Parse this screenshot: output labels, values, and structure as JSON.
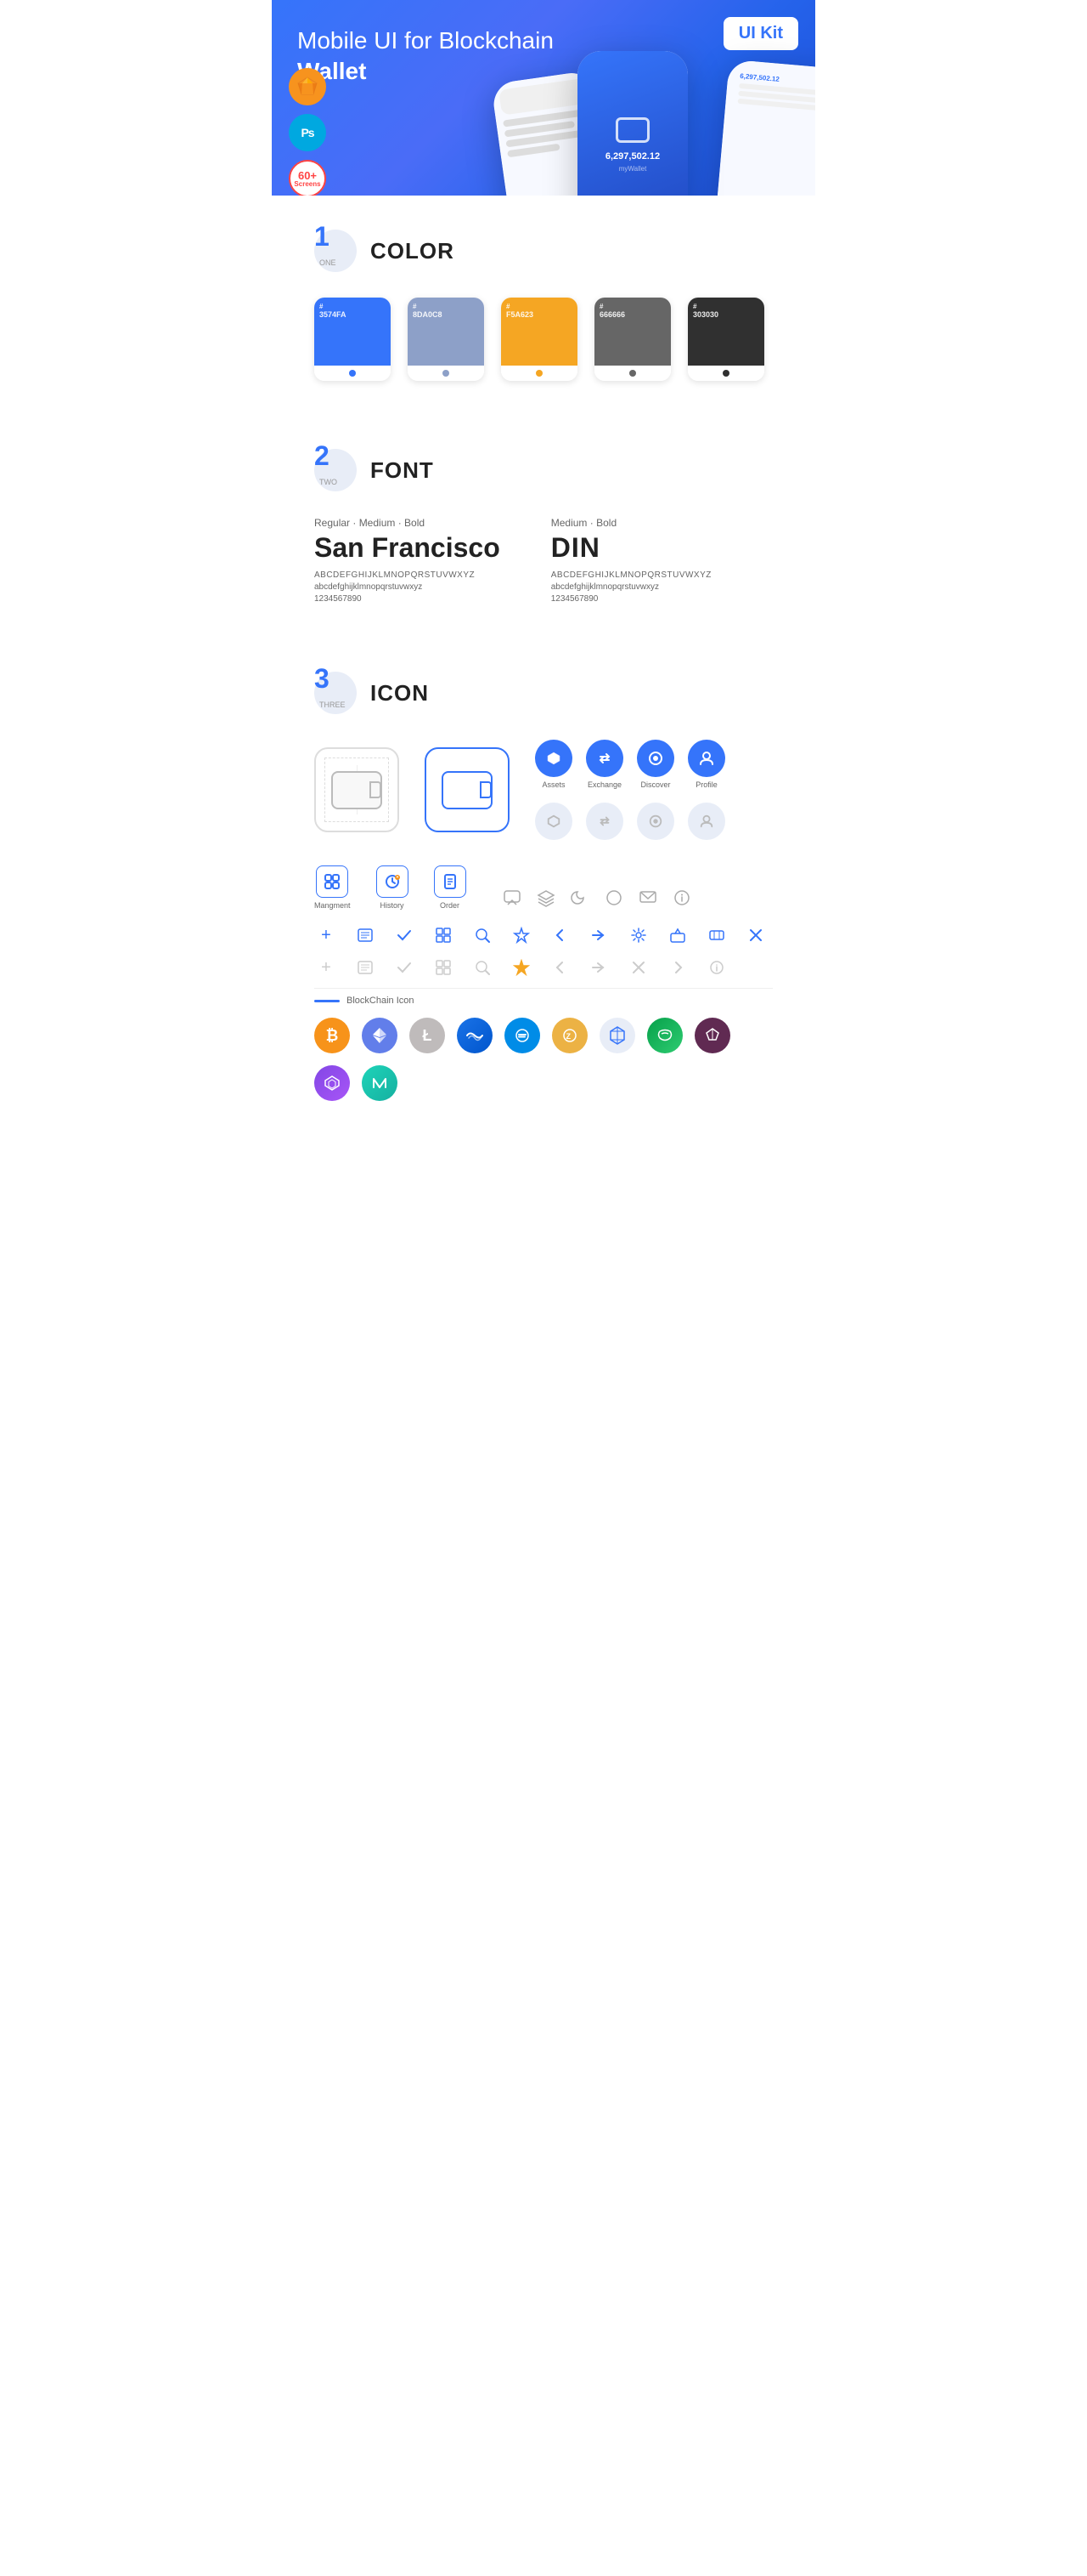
{
  "hero": {
    "title": "Mobile UI for Blockchain ",
    "title_bold": "Wallet",
    "ui_kit_label": "UI Kit",
    "badge_sketch": "S",
    "badge_ps": "Ps",
    "badge_screens_count": "60+",
    "badge_screens_label": "Screens"
  },
  "sections": {
    "color": {
      "number": "1",
      "sub": "ONE",
      "title": "COLOR",
      "swatches": [
        {
          "hex": "#3574FA",
          "label": "3574FA"
        },
        {
          "hex": "#8DA0C8",
          "label": "8DA0C8"
        },
        {
          "hex": "#F5A623",
          "label": "F5A623"
        },
        {
          "hex": "#666666",
          "label": "666666"
        },
        {
          "hex": "#303030",
          "label": "303030"
        }
      ]
    },
    "font": {
      "number": "2",
      "sub": "TWO",
      "title": "FONT",
      "fonts": [
        {
          "style": "Regular · Medium · Bold",
          "name": "San Francisco",
          "alphabet": "ABCDEFGHIJKLMNOPQRSTUVWXYZ",
          "lower": "abcdefghijklmnopqrstuvwxyz",
          "numbers": "1234567890"
        },
        {
          "style": "Medium · Bold",
          "name": "DIN",
          "alphabet": "ABCDEFGHIJKLMNOPQRSTUVWXYZ",
          "lower": "abcdefghijklmnopqrstuvwxyz",
          "numbers": "1234567890"
        }
      ]
    },
    "icon": {
      "number": "3",
      "sub": "THREE",
      "title": "ICON",
      "colored_icons": [
        {
          "label": "Assets",
          "symbol": "◆"
        },
        {
          "label": "Exchange",
          "symbol": "≋"
        },
        {
          "label": "Discover",
          "symbol": "●"
        },
        {
          "label": "Profile",
          "symbol": "👤"
        }
      ],
      "mgmt_icons": [
        {
          "label": "Mangment",
          "symbol": "▦"
        },
        {
          "label": "History",
          "symbol": "🕐"
        },
        {
          "label": "Order",
          "symbol": "📋"
        }
      ],
      "blockchain_label": "BlockChain Icon",
      "crypto_icons": [
        {
          "label": "BTC",
          "bg": "#f7931a",
          "symbol": "₿"
        },
        {
          "label": "ETH",
          "bg": "#627eea",
          "symbol": "Ξ"
        },
        {
          "label": "LTC",
          "bg": "#bfbbbb",
          "symbol": "Ł"
        },
        {
          "label": "WAVES",
          "bg": "#0055ff",
          "symbol": "〜"
        },
        {
          "label": "DASH",
          "bg": "#008ce7",
          "symbol": "D"
        },
        {
          "label": "ZEC",
          "bg": "#ecb244",
          "symbol": "Z"
        },
        {
          "label": "GRID",
          "bg": "#e8edf7",
          "symbol": "⬡"
        },
        {
          "label": "STEEM",
          "bg": "#4ba2f2",
          "symbol": "△"
        },
        {
          "label": "AUG",
          "bg": "#602a52",
          "symbol": "A"
        },
        {
          "label": "MATIC",
          "bg": "#8247e5",
          "symbol": "◇"
        },
        {
          "label": "NULS",
          "bg": "#1ed4b9",
          "symbol": "~"
        }
      ]
    }
  }
}
